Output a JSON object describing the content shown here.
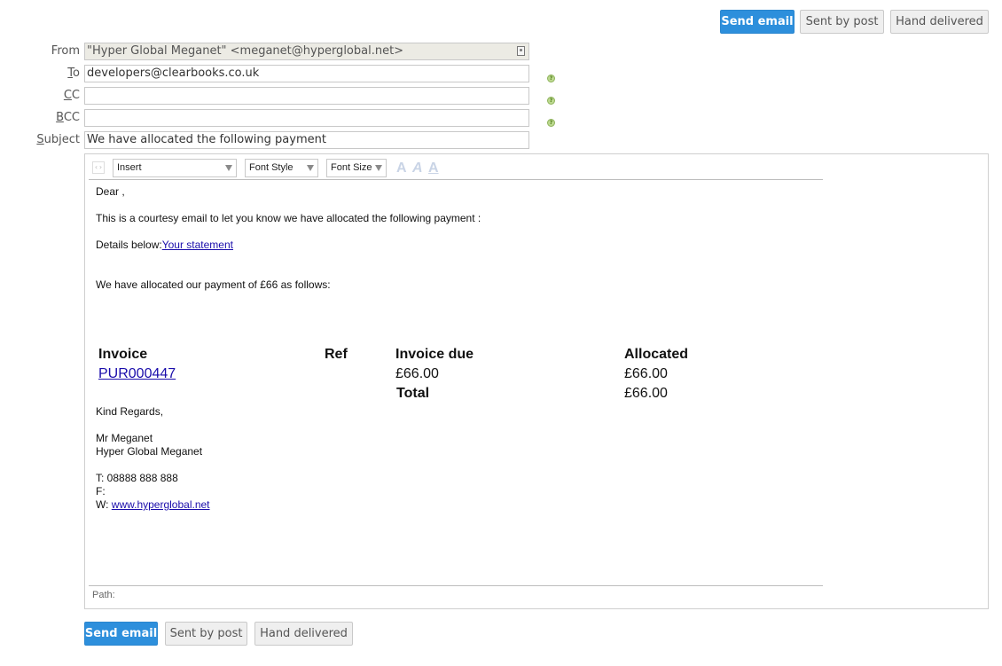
{
  "actions": {
    "send_email": "Send email",
    "sent_by_post": "Sent by post",
    "hand_delivered": "Hand delivered"
  },
  "form": {
    "from_label": "From",
    "to_label": "To",
    "to_key": "T",
    "to_rest": "o",
    "cc_label": "CC",
    "cc_key": "C",
    "cc_rest": "C",
    "bcc_key": "B",
    "bcc_rest": "CC",
    "subject_key": "S",
    "subject_rest": "ubject",
    "from_value": "\"Hyper Global Meganet\" <meganet@hyperglobal.net>",
    "to_value": "developers@clearbooks.co.uk",
    "cc_value": "",
    "bcc_value": "",
    "subject_value": "We have allocated the following payment",
    "help_glyph": "?"
  },
  "toolbar": {
    "source_glyph": "‹›",
    "insert": "Insert",
    "font_style": "Font Style",
    "font_size": "Font Size",
    "a_glyph": "A"
  },
  "body": {
    "greeting": "Dear ,",
    "intro": "This is a courtesy email to let you know we have allocated the following payment :",
    "details_label": "Details below:",
    "statement_link": "Your statement",
    "allocation_text": "We have allocated our payment of £66 as follows:",
    "table": {
      "headers": [
        "Invoice",
        "Ref",
        "Invoice due",
        "Allocated"
      ],
      "row": {
        "invoice": "PUR000447",
        "ref": "",
        "due": "£66.00",
        "allocated": "£66.00"
      },
      "total_label": "Total",
      "total_value": "£66.00"
    },
    "regards": "Kind Regards,",
    "name": "Mr Meganet",
    "company": "Hyper Global Meganet",
    "tel": "T: 08888 888 888",
    "fax": "F:",
    "web_label": "W: ",
    "web_link": "www.hyperglobal.net"
  },
  "pathbar": {
    "label": "Path:"
  },
  "colors": {
    "primary": "#2d8fdc",
    "link": "#1a0dab"
  }
}
